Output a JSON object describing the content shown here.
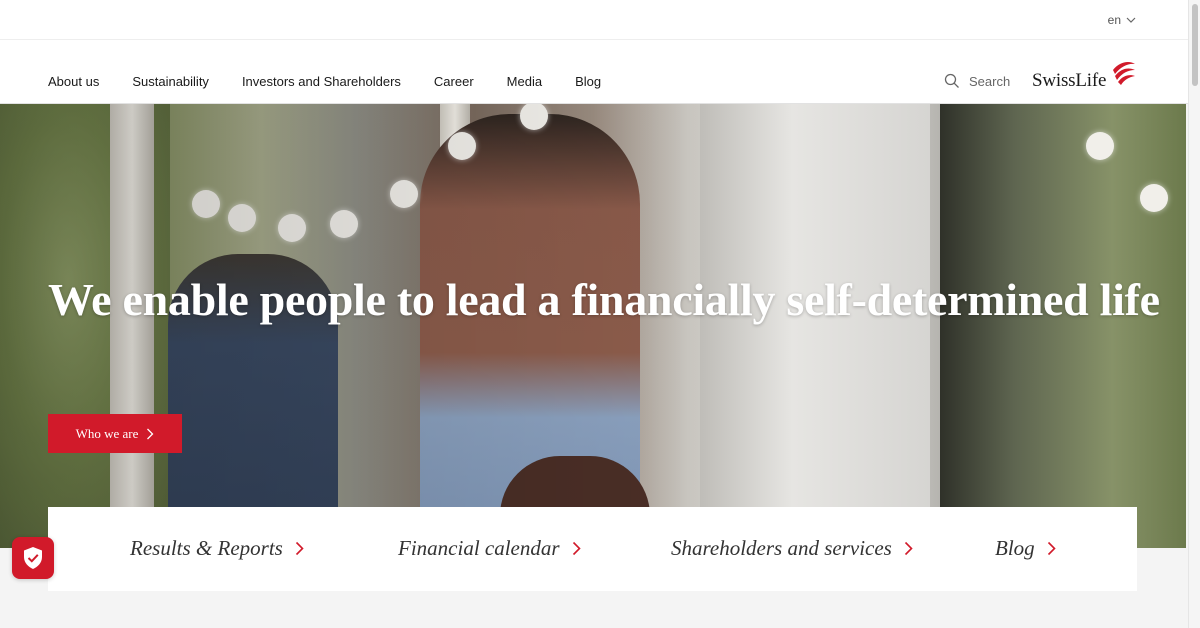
{
  "header": {
    "language": "en",
    "nav": [
      "About us",
      "Sustainability",
      "Investors and Shareholders",
      "Career",
      "Media",
      "Blog"
    ],
    "search_label": "Search",
    "logo_text": "SwissLife"
  },
  "hero": {
    "headline": "We enable people to lead a financially self-determined life",
    "cta_label": "Who we are"
  },
  "quick_links": [
    "Results & Reports",
    "Financial calendar",
    "Shareholders and services",
    "Blog"
  ],
  "colors": {
    "accent": "#d11a2a",
    "text": "#1a1a1a",
    "background": "#f4f4f4"
  },
  "icons": {
    "language": "chevron-down-icon",
    "search": "search-icon",
    "logo": "swisslife-logo-icon",
    "cta": "chevron-right-icon",
    "quick_links": "chevron-right-icon",
    "privacy": "shield-check-icon"
  }
}
